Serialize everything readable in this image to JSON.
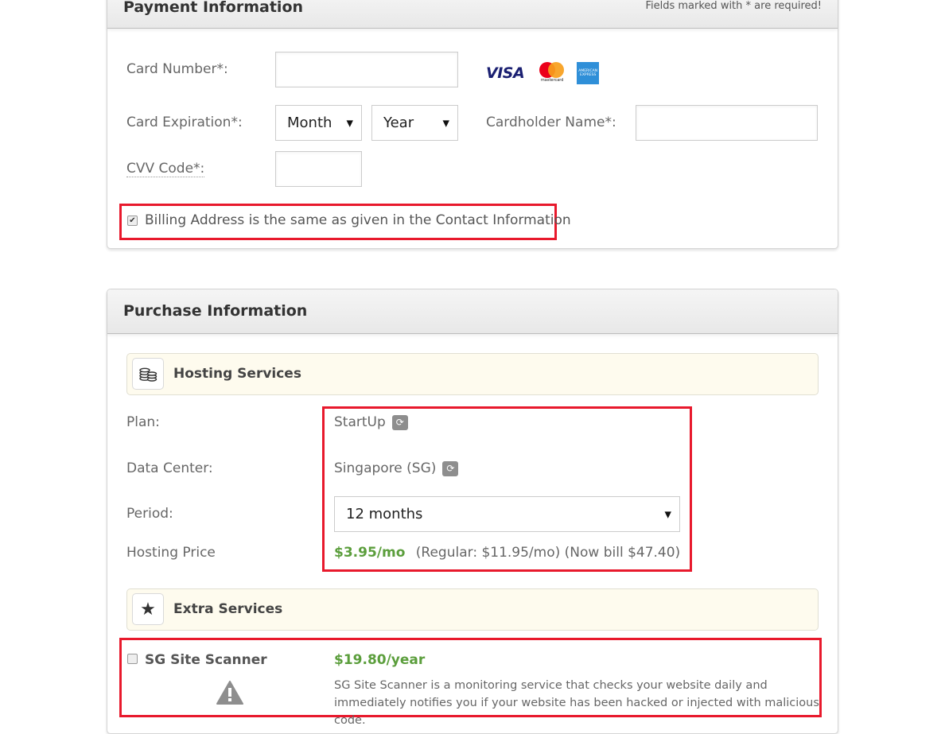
{
  "payment": {
    "title": "Payment Information",
    "required_note": "Fields marked with * are required!",
    "card_number_label": "Card Number*:",
    "card_number_value": "",
    "card_logos": {
      "visa": "VISA",
      "mastercard": "mastercard",
      "amex": "AMERICAN EXPRESS"
    },
    "card_expiration_label": "Card Expiration*:",
    "month_select": {
      "selected": "Month"
    },
    "year_select": {
      "selected": "Year"
    },
    "cardholder_label": "Cardholder Name*:",
    "cardholder_value": "",
    "cvv_label": "CVV Code*:",
    "cvv_value": "",
    "billing_same": {
      "checked": true,
      "label": "Billing Address is the same as given in the Contact Information"
    }
  },
  "purchase": {
    "title": "Purchase Information",
    "hosting": {
      "section_title": "Hosting Services",
      "icon": "coins-icon",
      "plan_label": "Plan:",
      "plan_value": "StartUp",
      "data_center_label": "Data Center:",
      "data_center_value": "Singapore (SG)",
      "period_label": "Period:",
      "period_selected": "12 months",
      "price_label": "Hosting Price",
      "price_promo": "$3.95/mo",
      "price_regular": "(Regular: $11.95/mo) (Now bill $47.40)"
    },
    "extra": {
      "section_title": "Extra Services",
      "icon": "star-icon",
      "site_scanner": {
        "checked": false,
        "name": "SG Site Scanner",
        "price": "$19.80/year",
        "description": "SG Site Scanner is a monitoring service that checks your website daily and immediately notifies you if your website has been hacked or injected with malicious code."
      }
    }
  },
  "colors": {
    "highlight_red": "#e8192c",
    "price_green": "#5b9e3c",
    "section_bg": "#fefbee"
  }
}
